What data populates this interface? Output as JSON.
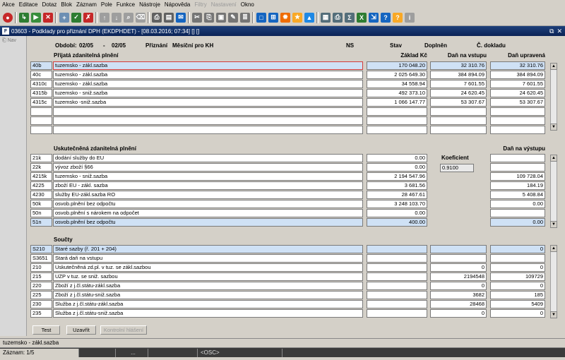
{
  "menu": [
    "Akce",
    "Editace",
    "Dotaz",
    "Blok",
    "Záznam",
    "Pole",
    "Funkce",
    "Nástroje",
    "Nápověda",
    "Filtry",
    "Nastavení",
    "Okno"
  ],
  "menu_disabled": [
    "Filtry",
    "Nastavení"
  ],
  "window": {
    "title": "03603 - Podklady pro přiznání DPH (EKDPHDET) - [08.03.2016; 07:34] [] []",
    "logo": "F"
  },
  "nav": {
    "label": "Nav"
  },
  "header": {
    "obdobi_label": "Období:",
    "obdobi_from": "02/05",
    "obdobi_sep": "-",
    "obdobi_to": "02/05",
    "priznani_label": "Přiznání",
    "priznani_value": "Měsíční pro KH",
    "ns_label": "NS",
    "stav_label": "Stav",
    "doplnen_label": "Doplněn",
    "cdokladu_label": "Č. dokladu"
  },
  "prijata": {
    "title": "Přijatá zdanitelná plnění",
    "col_zaklad": "Základ Kč",
    "col_dan_vstup": "Daň na vstupu",
    "col_dan_upr": "Daň upravená",
    "rows": [
      {
        "code": "40b",
        "name": "tuzemsko - zákl.sazba",
        "zaklad": "170 048.20",
        "dan": "32 310.76",
        "upr": "32 310.76"
      },
      {
        "code": "40c",
        "name": "tuzemsko - zákl.sazba",
        "zaklad": "2 025 649.30",
        "dan": "384 894.09",
        "upr": "384 894.09"
      },
      {
        "code": "4310c",
        "name": "tuzemsko - zákl.sazba",
        "zaklad": "34 558.94",
        "dan": "7 601.55",
        "upr": "7 601.55"
      },
      {
        "code": "4315b",
        "name": "tuzemsko - sniž.sazba",
        "zaklad": "492 373.10",
        "dan": "24 620.45",
        "upr": "24 620.45"
      },
      {
        "code": "4315c",
        "name": "tuzemsko -sniž.sazba",
        "zaklad": "1 066 147.77",
        "dan": "53 307.67",
        "upr": "53 307.67"
      },
      {
        "code": "",
        "name": "",
        "zaklad": "",
        "dan": "",
        "upr": ""
      },
      {
        "code": "",
        "name": "",
        "zaklad": "",
        "dan": "",
        "upr": ""
      },
      {
        "code": "",
        "name": "",
        "zaklad": "",
        "dan": "",
        "upr": ""
      }
    ]
  },
  "uskutecnena": {
    "title": "Uskutečněná zdanitelná plnění",
    "col_dan_vystup": "Daň na výstupu",
    "koef_label": "Koeficient",
    "koef_value": "0.9100",
    "rows": [
      {
        "code": "21k",
        "name": "dodání služby do EU",
        "zaklad": "0.00",
        "dan": ""
      },
      {
        "code": "22k",
        "name": "vývoz zboží §66",
        "zaklad": "0.00",
        "dan": ""
      },
      {
        "code": "4215k",
        "name": "tuzemsko - sniž.sazba",
        "zaklad": "2 194 547.96",
        "dan": "109 728.04"
      },
      {
        "code": "4225",
        "name": "zboží EU - zákl. sazba",
        "zaklad": "3 681.56",
        "dan": "184.19"
      },
      {
        "code": "4230",
        "name": "služby EU-zákl.sazba RO",
        "zaklad": "28 467.61",
        "dan": "5 408.84"
      },
      {
        "code": "50k",
        "name": "osvob.plnění bez odpočtu",
        "zaklad": "3 248 103.70",
        "dan": "0.00"
      },
      {
        "code": "50n",
        "name": "osvob.plnění s nárokem na odpočet",
        "zaklad": "0.00",
        "dan": ""
      },
      {
        "code": "51n",
        "name": "osvob.plnění bez odpočtu",
        "zaklad": "400.00",
        "dan": "0.00"
      }
    ]
  },
  "soucty": {
    "title": "Součty",
    "rows": [
      {
        "code": "S210",
        "name": "Staré sazby (ř. 201 + 204)",
        "zaklad": "",
        "dan": "",
        "upr": "0"
      },
      {
        "code": "S3651",
        "name": "Stará daň na vstupu",
        "zaklad": "",
        "dan": "",
        "upr": ""
      },
      {
        "code": "210",
        "name": "Uskutečněná zd.pl. v tuz. se zákl.sazbou",
        "zaklad": "",
        "dan": "0",
        "upr": "0"
      },
      {
        "code": "215",
        "name": "UZP v tuz. se sniž. sazbou",
        "zaklad": "",
        "dan": "2194548",
        "upr": "109729"
      },
      {
        "code": "220",
        "name": "Zboží z j.čl.státu-zákl.sazba",
        "zaklad": "",
        "dan": "0",
        "upr": "0"
      },
      {
        "code": "225",
        "name": "Zboží z j.čl.státu-sniž.sazba",
        "zaklad": "",
        "dan": "3682",
        "upr": "185"
      },
      {
        "code": "230",
        "name": "Služba z j.čl.státu-zákl.sazba",
        "zaklad": "",
        "dan": "28468",
        "upr": "5409"
      },
      {
        "code": "235",
        "name": "Služba z j.čl.státu-sniž.sazba",
        "zaklad": "",
        "dan": "0",
        "upr": "0"
      }
    ]
  },
  "buttons": {
    "test": "Test",
    "uzavrit": "Uzavřít",
    "kontrolni": "Kontrolní hlášení"
  },
  "status": {
    "message": "tuzemsko - zákl.sazba",
    "record": "Záznam: 1/5",
    "dots": "...",
    "osc": "<OSC>"
  },
  "colors": {
    "title_bar": "#0b2356",
    "selected_border": "#d23c3c",
    "highlight": "#cfe1f5"
  }
}
